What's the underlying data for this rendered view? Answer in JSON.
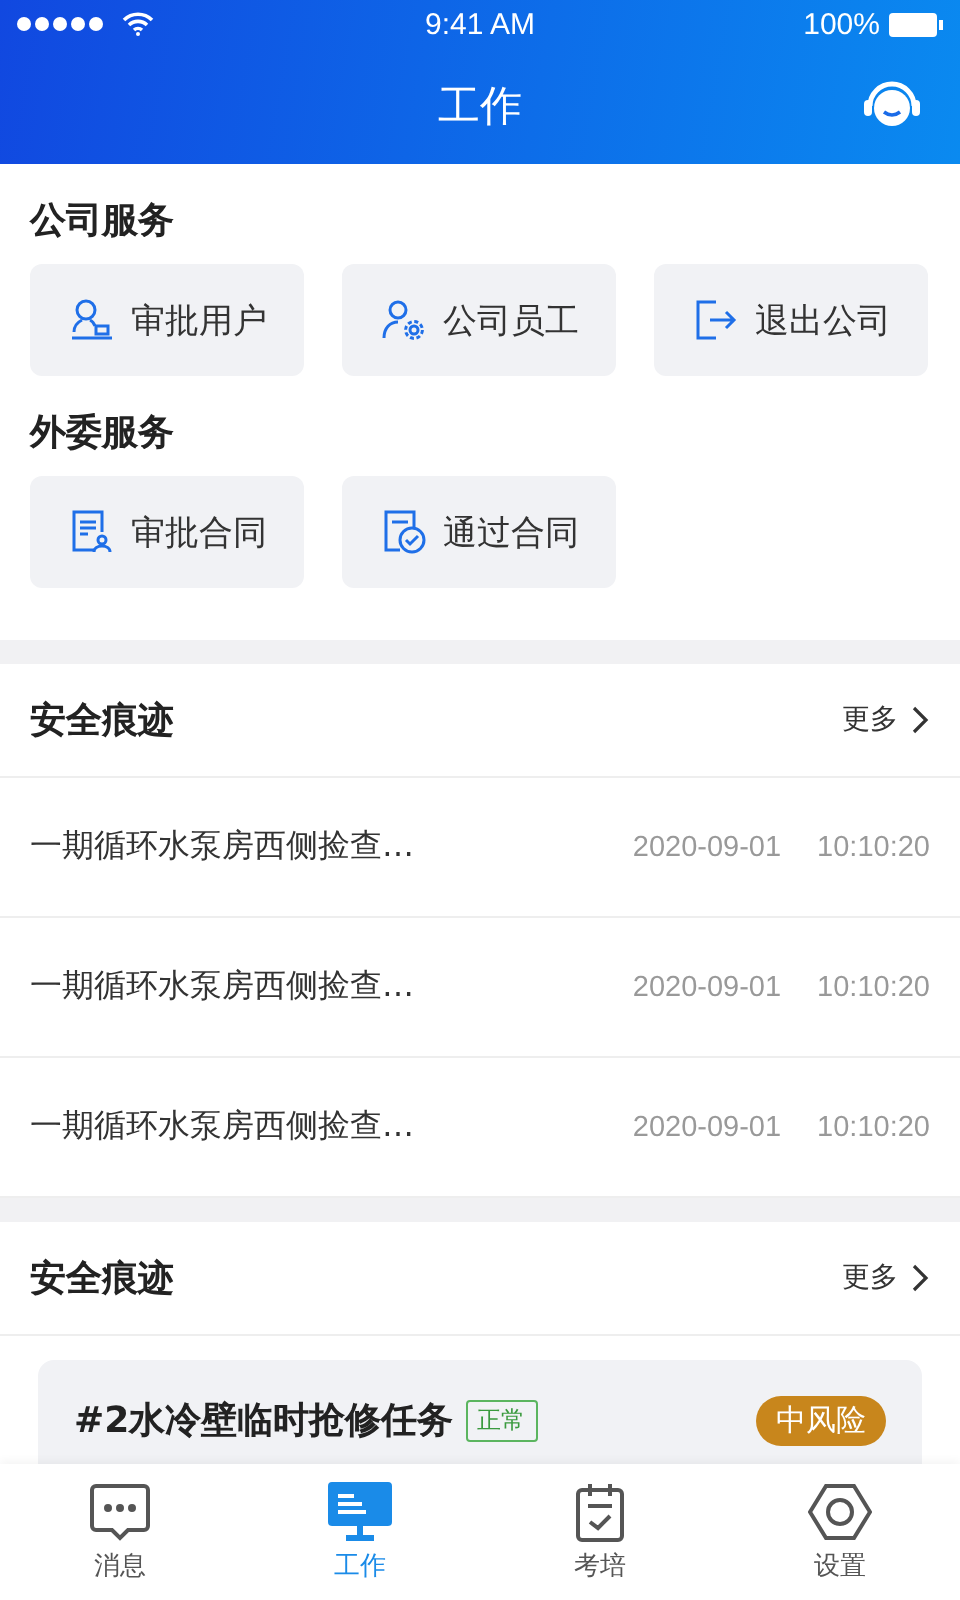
{
  "status_bar": {
    "time": "9:41 AM",
    "battery": "100%"
  },
  "header": {
    "title": "工作"
  },
  "service_groups": [
    {
      "title": "公司服务",
      "items": [
        {
          "label": "审批用户"
        },
        {
          "label": "公司员工"
        },
        {
          "label": "退出公司"
        }
      ]
    },
    {
      "title": "外委服务",
      "items": [
        {
          "label": "审批合同"
        },
        {
          "label": "通过合同"
        }
      ]
    }
  ],
  "trace_section": {
    "title": "安全痕迹",
    "more": "更多",
    "rows": [
      {
        "text": "一期循环水泵房西侧捡查…",
        "date": "2020-09-01",
        "time": "10:10:20"
      },
      {
        "text": "一期循环水泵房西侧捡查…",
        "date": "2020-09-01",
        "time": "10:10:20"
      },
      {
        "text": "一期循环水泵房西侧捡查…",
        "date": "2020-09-01",
        "time": "10:10:20"
      }
    ]
  },
  "task_section": {
    "title": "安全痕迹",
    "more": "更多",
    "task": {
      "title": "#2水冷壁临时抢修任务",
      "status": "正常",
      "risk": "中风险"
    }
  },
  "tab_bar": [
    {
      "label": "消息",
      "selected": false
    },
    {
      "label": "工作",
      "selected": true
    },
    {
      "label": "考培",
      "selected": false
    },
    {
      "label": "设置",
      "selected": false
    }
  ]
}
